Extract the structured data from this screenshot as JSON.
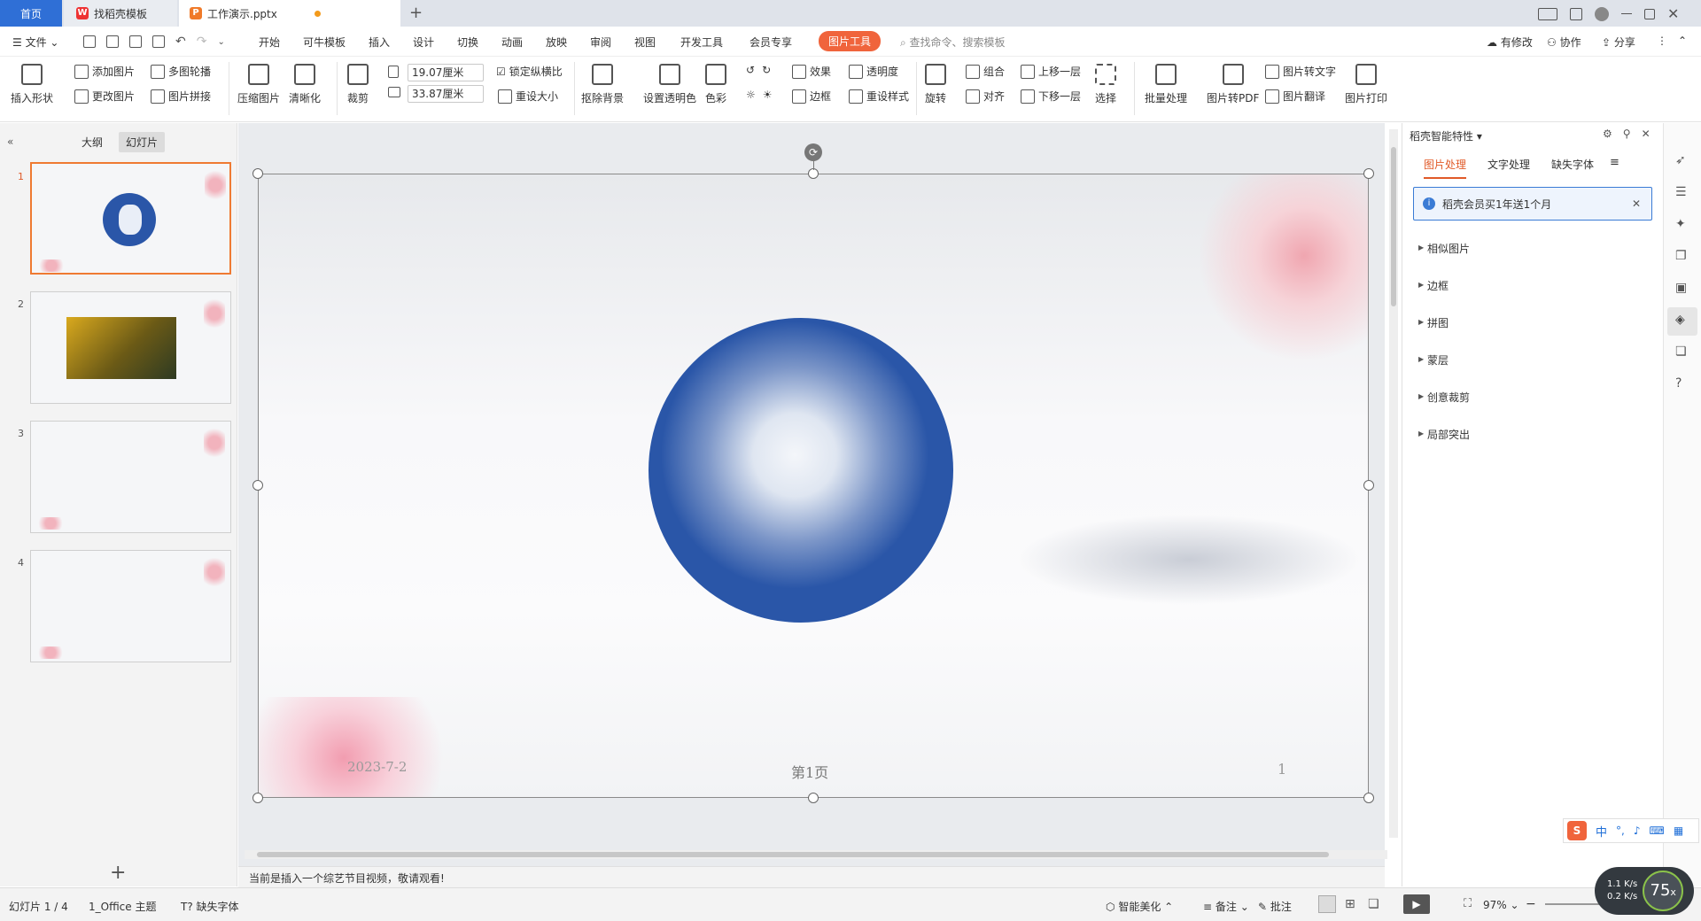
{
  "tabs": {
    "home": "首页",
    "template": "找稻壳模板",
    "document": "工作演示.pptx",
    "new_tab": "+"
  },
  "menu": {
    "file": "文件",
    "items": [
      "开始",
      "可牛模板",
      "插入",
      "设计",
      "切换",
      "动画",
      "放映",
      "审阅",
      "视图",
      "开发工具",
      "会员专享"
    ],
    "picture_tools": "图片工具",
    "search_placeholder": "查找命令、搜索模板",
    "has_changes": "有修改",
    "collaborate": "协作",
    "share": "分享"
  },
  "ribbon": {
    "insert_shape": "插入形状",
    "add_picture": "添加图片",
    "change_picture": "更改图片",
    "multi_carousel": "多图轮播",
    "picture_stitch": "图片拼接",
    "compress": "压缩图片",
    "sharpen": "清晰化",
    "crop": "裁剪",
    "height": "19.07厘米",
    "width": "33.87厘米",
    "lock_ratio": "锁定纵横比",
    "reset_size": "重设大小",
    "remove_bg": "抠除背景",
    "set_transparent": "设置透明色",
    "color": "色彩",
    "effects": "效果",
    "transparency": "透明度",
    "border": "边框",
    "reset_style": "重设样式",
    "rotate": "旋转",
    "group": "组合",
    "align": "对齐",
    "bring_forward": "上移一层",
    "send_backward": "下移一层",
    "select": "选择",
    "batch": "批量处理",
    "to_pdf": "图片转PDF",
    "to_text": "图片转文字",
    "translate": "图片翻译",
    "print": "图片打印"
  },
  "left_panel": {
    "outline": "大纲",
    "slides": "幻灯片",
    "slide_numbers": [
      "1",
      "2",
      "3",
      "4"
    ],
    "add": "+"
  },
  "slide": {
    "date": "2023-7-2",
    "page_label": "第1页",
    "page_num": "1"
  },
  "notice": "当前是插入一个综艺节目视频，敬请观看!",
  "right_panel": {
    "title": "稻壳智能特性",
    "tabs": [
      "图片处理",
      "文字处理",
      "缺失字体"
    ],
    "promo": "稻壳会员买1年送1个月",
    "items": [
      "相似图片",
      "边框",
      "拼图",
      "蒙层",
      "创意裁剪",
      "局部突出"
    ]
  },
  "status_bar": {
    "slide_info": "幻灯片 1 / 4",
    "theme": "1_Office 主题",
    "missing_font": "缺失字体",
    "smart_beautify": "智能美化",
    "notes": "备注",
    "comments": "批注",
    "zoom": "97%",
    "net_up": "1.1",
    "net_down": "0.2",
    "net_unit": "K/s",
    "speed_badge": "75",
    "speed_unit": "x"
  },
  "ime": {
    "mode": "中"
  },
  "colors": {
    "accent": "#f0643c",
    "home_tab": "#2f6fd6",
    "slide_circle": "#2a56a8"
  }
}
